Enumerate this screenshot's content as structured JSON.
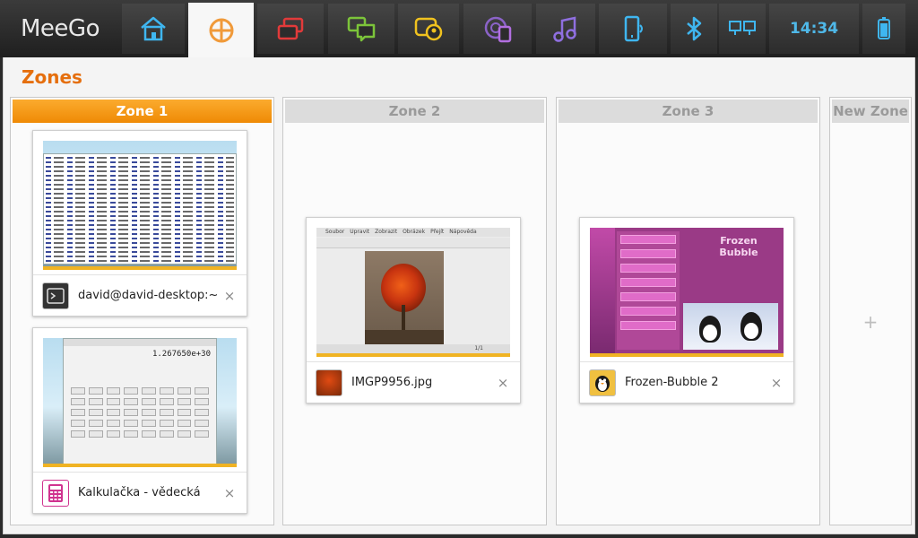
{
  "panel": {
    "logo": "MeeGo",
    "clock": "14:34",
    "items": [
      {
        "name": "home-icon"
      },
      {
        "name": "zones-icon"
      },
      {
        "name": "applications-icon"
      },
      {
        "name": "messaging-icon"
      },
      {
        "name": "people-icon"
      },
      {
        "name": "web-icon"
      },
      {
        "name": "music-icon"
      },
      {
        "name": "devices-icon"
      },
      {
        "name": "bluetooth-icon"
      },
      {
        "name": "network-icon"
      },
      {
        "name": "battery-icon"
      }
    ],
    "colors": {
      "accent_orange": "#ef8a05",
      "clock_blue": "#4fb8e8"
    }
  },
  "page": {
    "title": "Zones",
    "zones": [
      {
        "label": "Zone 1",
        "active": true
      },
      {
        "label": "Zone 2",
        "active": false
      },
      {
        "label": "Zone 3",
        "active": false
      },
      {
        "label": "New Zone",
        "active": false,
        "add_symbol": "+"
      }
    ],
    "windows": [
      {
        "title": "david@david-desktop:~",
        "icon": "terminal-icon",
        "zone": 1
      },
      {
        "title": "Kalkulačka - vědecká",
        "icon": "calculator-icon",
        "zone": 1
      },
      {
        "title": "IMGP9956.jpg",
        "icon": "image-icon",
        "zone": 2
      },
      {
        "title": "Frozen-Bubble 2",
        "icon": "penguin-icon",
        "zone": 3
      }
    ],
    "close_symbol": "×"
  },
  "thumbnails": {
    "calculator_display": "1.267650e+30",
    "image_viewer_menu": [
      "Soubor",
      "Upravit",
      "Zobrazit",
      "Obrázek",
      "Přejít",
      "Nápověda"
    ],
    "image_viewer_status": "1/1",
    "game_title": "Frozen Bubble"
  }
}
